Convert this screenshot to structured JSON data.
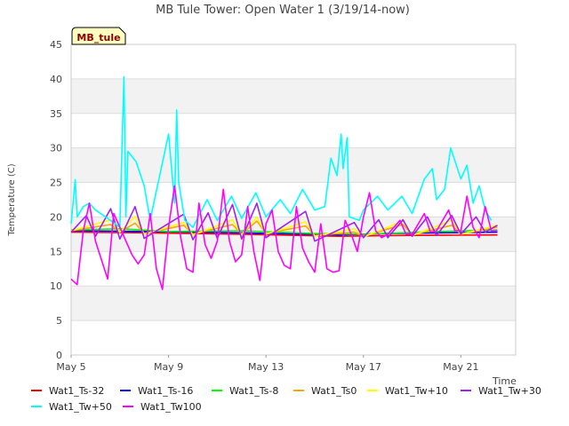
{
  "chart_data": {
    "type": "line",
    "title": "MB Tule Tower: Open Water 1 (3/19/14-now)",
    "xlabel": "Time",
    "ylabel": "Temperature (C)",
    "site_tag": "MB_tule",
    "ylim": [
      0,
      45
    ],
    "xlim": [
      "2014-05-05",
      "2014-05-23T06:00"
    ],
    "y_ticks": [
      0,
      5,
      10,
      15,
      20,
      25,
      30,
      35,
      40,
      45
    ],
    "x_ticks": [
      {
        "date": "2014-05-05",
        "label": "May 5"
      },
      {
        "date": "2014-05-09",
        "label": "May 9"
      },
      {
        "date": "2014-05-13",
        "label": "May 13"
      },
      {
        "date": "2014-05-17",
        "label": "May 17"
      },
      {
        "date": "2014-05-21",
        "label": "May 21"
      }
    ],
    "grid": "horizontal bands",
    "legend_position": "bottom",
    "series": [
      {
        "name": "Wat1_Ts-32",
        "color": "#ff0000",
        "points": [
          [
            "2014-05-05",
            17.8
          ],
          [
            "2014-05-08",
            17.7
          ],
          [
            "2014-05-12",
            17.5
          ],
          [
            "2014-05-16",
            17.2
          ],
          [
            "2014-05-18",
            17.3
          ],
          [
            "2014-05-22T12:00",
            17.4
          ]
        ]
      },
      {
        "name": "Wat1_Ts-16",
        "color": "#0000ff",
        "points": [
          [
            "2014-05-05",
            18.0
          ],
          [
            "2014-05-08",
            17.9
          ],
          [
            "2014-05-12",
            17.7
          ],
          [
            "2014-05-16",
            17.4
          ],
          [
            "2014-05-18",
            17.6
          ],
          [
            "2014-05-22T12:00",
            17.8
          ]
        ]
      },
      {
        "name": "Wat1_Ts-8",
        "color": "#00ff00",
        "points": [
          [
            "2014-05-05",
            18.1
          ],
          [
            "2014-05-07",
            18.3
          ],
          [
            "2014-05-09",
            17.9
          ],
          [
            "2014-05-12",
            18.0
          ],
          [
            "2014-05-15",
            17.6
          ],
          [
            "2014-05-17",
            17.5
          ],
          [
            "2014-05-20",
            17.9
          ],
          [
            "2014-05-22T12:00",
            18.1
          ]
        ]
      },
      {
        "name": "Wat1_Ts0",
        "color": "#ffa500",
        "points": [
          [
            "2014-05-05",
            18.0
          ],
          [
            "2014-05-06T15:00",
            18.9
          ],
          [
            "2014-05-07",
            17.8
          ],
          [
            "2014-05-07T15:00",
            19.1
          ],
          [
            "2014-05-08",
            17.6
          ],
          [
            "2014-05-09T15:00",
            18.8
          ],
          [
            "2014-05-10",
            17.5
          ],
          [
            "2014-05-11T15:00",
            18.9
          ],
          [
            "2014-05-12",
            17.5
          ],
          [
            "2014-05-12T15:00",
            19.4
          ],
          [
            "2014-05-13",
            17.6
          ],
          [
            "2014-05-14T15:00",
            18.7
          ],
          [
            "2014-05-15",
            17.3
          ],
          [
            "2014-05-16T15:00",
            17.8
          ],
          [
            "2014-05-17",
            17.2
          ],
          [
            "2014-05-18T15:00",
            18.9
          ],
          [
            "2014-05-19",
            17.4
          ],
          [
            "2014-05-20T15:00",
            18.8
          ],
          [
            "2014-05-21",
            17.5
          ],
          [
            "2014-05-22T12:00",
            18.5
          ]
        ]
      },
      {
        "name": "Wat1_Tw+10",
        "color": "#ffff00",
        "points": [
          [
            "2014-05-05",
            18.0
          ],
          [
            "2014-05-06T15:00",
            19.6
          ],
          [
            "2014-05-07",
            17.8
          ],
          [
            "2014-05-07T15:00",
            20.1
          ],
          [
            "2014-05-08",
            17.5
          ],
          [
            "2014-05-09T15:00",
            19.2
          ],
          [
            "2014-05-10",
            17.4
          ],
          [
            "2014-05-11T15:00",
            19.6
          ],
          [
            "2014-05-12",
            17.4
          ],
          [
            "2014-05-12T15:00",
            20.0
          ],
          [
            "2014-05-13",
            17.5
          ],
          [
            "2014-05-14T15:00",
            19.3
          ],
          [
            "2014-05-15",
            17.2
          ],
          [
            "2014-05-16T15:00",
            18.3
          ],
          [
            "2014-05-17",
            17.1
          ],
          [
            "2014-05-18T15:00",
            19.4
          ],
          [
            "2014-05-19",
            17.3
          ],
          [
            "2014-05-20T15:00",
            19.5
          ],
          [
            "2014-05-21",
            17.5
          ],
          [
            "2014-05-22T12:00",
            18.8
          ]
        ]
      },
      {
        "name": "Wat1_Tw+30",
        "color": "#a020f0",
        "points": [
          [
            "2014-05-05",
            17.8
          ],
          [
            "2014-05-05T15:00",
            20.2
          ],
          [
            "2014-05-06",
            17.2
          ],
          [
            "2014-05-06T15:00",
            21.2
          ],
          [
            "2014-05-07",
            16.8
          ],
          [
            "2014-05-07T15:00",
            21.5
          ],
          [
            "2014-05-08",
            16.9
          ],
          [
            "2014-05-09T15:00",
            20.4
          ],
          [
            "2014-05-10",
            16.7
          ],
          [
            "2014-05-10T15:00",
            20.6
          ],
          [
            "2014-05-11",
            16.9
          ],
          [
            "2014-05-11T15:00",
            21.8
          ],
          [
            "2014-05-12",
            16.8
          ],
          [
            "2014-05-12T15:00",
            22.0
          ],
          [
            "2014-05-13",
            17.0
          ],
          [
            "2014-05-14T15:00",
            20.8
          ],
          [
            "2014-05-15",
            16.5
          ],
          [
            "2014-05-16T15:00",
            19.2
          ],
          [
            "2014-05-17",
            17.0
          ],
          [
            "2014-05-17T15:00",
            19.6
          ],
          [
            "2014-05-18",
            17.0
          ],
          [
            "2014-05-18T15:00",
            19.6
          ],
          [
            "2014-05-19",
            17.2
          ],
          [
            "2014-05-19T15:00",
            20.0
          ],
          [
            "2014-05-20",
            17.3
          ],
          [
            "2014-05-20T15:00",
            20.2
          ],
          [
            "2014-05-21",
            17.5
          ],
          [
            "2014-05-21T15:00",
            20.0
          ],
          [
            "2014-05-22",
            17.8
          ],
          [
            "2014-05-22T12:00",
            18.8
          ]
        ]
      },
      {
        "name": "Wat1_Tw+50",
        "color": "#00ffff",
        "points": [
          [
            "2014-05-05T00:00",
            19.0
          ],
          [
            "2014-05-05T04:00",
            25.4
          ],
          [
            "2014-05-05T06:00",
            20.0
          ],
          [
            "2014-05-05T12:00",
            21.5
          ],
          [
            "2014-05-05T18:00",
            22.0
          ],
          [
            "2014-05-06T00:00",
            21.0
          ],
          [
            "2014-05-06T12:00",
            19.8
          ],
          [
            "2014-05-07T00:00",
            18.5
          ],
          [
            "2014-05-07T04:00",
            40.3
          ],
          [
            "2014-05-07T06:00",
            20.0
          ],
          [
            "2014-05-07T08:00",
            29.5
          ],
          [
            "2014-05-07T16:00",
            28.0
          ],
          [
            "2014-05-08T00:00",
            24.5
          ],
          [
            "2014-05-08T06:00",
            19.5
          ],
          [
            "2014-05-08T08:00",
            21.0
          ],
          [
            "2014-05-09T00:00",
            32.0
          ],
          [
            "2014-05-09T06:00",
            22.0
          ],
          [
            "2014-05-09T08:00",
            35.5
          ],
          [
            "2014-05-09T10:00",
            25.0
          ],
          [
            "2014-05-09T16:00",
            19.5
          ],
          [
            "2014-05-10T00:00",
            18.5
          ],
          [
            "2014-05-10T14:00",
            22.5
          ],
          [
            "2014-05-11T00:00",
            19.5
          ],
          [
            "2014-05-11T14:00",
            23.0
          ],
          [
            "2014-05-12T00:00",
            19.8
          ],
          [
            "2014-05-12T14:00",
            23.5
          ],
          [
            "2014-05-13T00:00",
            20.0
          ],
          [
            "2014-05-13T14:00",
            22.5
          ],
          [
            "2014-05-14T00:00",
            20.5
          ],
          [
            "2014-05-14T12:00",
            24.0
          ],
          [
            "2014-05-15T00:00",
            21.0
          ],
          [
            "2014-05-15T10:00",
            21.5
          ],
          [
            "2014-05-15T16:00",
            28.5
          ],
          [
            "2014-05-15T22:00",
            26.0
          ],
          [
            "2014-05-16T02:00",
            32.0
          ],
          [
            "2014-05-16T04:00",
            27.0
          ],
          [
            "2014-05-16T08:00",
            31.5
          ],
          [
            "2014-05-16T10:00",
            20.0
          ],
          [
            "2014-05-16T20:00",
            19.5
          ],
          [
            "2014-05-17T00:00",
            21.0
          ],
          [
            "2014-05-17T14:00",
            23.0
          ],
          [
            "2014-05-18T00:00",
            21.0
          ],
          [
            "2014-05-18T14:00",
            23.0
          ],
          [
            "2014-05-19T00:00",
            20.5
          ],
          [
            "2014-05-19T12:00",
            25.5
          ],
          [
            "2014-05-19T20:00",
            27.0
          ],
          [
            "2014-05-20T00:00",
            22.5
          ],
          [
            "2014-05-20T08:00",
            24.0
          ],
          [
            "2014-05-20T14:00",
            30.0
          ],
          [
            "2014-05-21T00:00",
            25.5
          ],
          [
            "2014-05-21T06:00",
            27.5
          ],
          [
            "2014-05-21T12:00",
            22.0
          ],
          [
            "2014-05-21T18:00",
            24.5
          ],
          [
            "2014-05-22T00:00",
            21.0
          ],
          [
            "2014-05-22T06:00",
            19.5
          ]
        ]
      },
      {
        "name": "Wat1_Tw100",
        "color": "#ff00ff",
        "points": [
          [
            "2014-05-05T00:00",
            11.0
          ],
          [
            "2014-05-05T06:00",
            10.2
          ],
          [
            "2014-05-05T12:00",
            18.0
          ],
          [
            "2014-05-05T18:00",
            22.0
          ],
          [
            "2014-05-06T00:00",
            16.5
          ],
          [
            "2014-05-06T12:00",
            11.0
          ],
          [
            "2014-05-06T18:00",
            20.5
          ],
          [
            "2014-05-07T00:00",
            18.5
          ],
          [
            "2014-05-07T12:00",
            14.5
          ],
          [
            "2014-05-07T18:00",
            13.2
          ],
          [
            "2014-05-08T00:00",
            14.5
          ],
          [
            "2014-05-08T06:00",
            20.5
          ],
          [
            "2014-05-08T12:00",
            12.5
          ],
          [
            "2014-05-08T18:00",
            9.5
          ],
          [
            "2014-05-09T00:00",
            18.5
          ],
          [
            "2014-05-09T06:00",
            24.5
          ],
          [
            "2014-05-09T12:00",
            17.0
          ],
          [
            "2014-05-09T18:00",
            12.5
          ],
          [
            "2014-05-10T00:00",
            12.0
          ],
          [
            "2014-05-10T06:00",
            22.0
          ],
          [
            "2014-05-10T12:00",
            16.0
          ],
          [
            "2014-05-10T18:00",
            14.0
          ],
          [
            "2014-05-11T00:00",
            16.5
          ],
          [
            "2014-05-11T06:00",
            24.0
          ],
          [
            "2014-05-11T12:00",
            16.5
          ],
          [
            "2014-05-11T18:00",
            13.5
          ],
          [
            "2014-05-12T00:00",
            14.5
          ],
          [
            "2014-05-12T06:00",
            21.5
          ],
          [
            "2014-05-12T12:00",
            15.0
          ],
          [
            "2014-05-12T18:00",
            10.8
          ],
          [
            "2014-05-13T00:00",
            19.0
          ],
          [
            "2014-05-13T06:00",
            21.0
          ],
          [
            "2014-05-13T12:00",
            15.0
          ],
          [
            "2014-05-13T18:00",
            13.0
          ],
          [
            "2014-05-14T00:00",
            12.5
          ],
          [
            "2014-05-14T06:00",
            21.5
          ],
          [
            "2014-05-14T12:00",
            15.5
          ],
          [
            "2014-05-14T18:00",
            13.5
          ],
          [
            "2014-05-15T00:00",
            12.0
          ],
          [
            "2014-05-15T06:00",
            19.0
          ],
          [
            "2014-05-15T12:00",
            12.5
          ],
          [
            "2014-05-15T18:00",
            12.0
          ],
          [
            "2014-05-16T00:00",
            12.2
          ],
          [
            "2014-05-16T06:00",
            19.5
          ],
          [
            "2014-05-16T12:00",
            17.5
          ],
          [
            "2014-05-16T18:00",
            15.0
          ],
          [
            "2014-05-17T00:00",
            20.0
          ],
          [
            "2014-05-17T06:00",
            23.5
          ],
          [
            "2014-05-17T12:00",
            18.0
          ],
          [
            "2014-05-17T18:00",
            17.0
          ],
          [
            "2014-05-18T00:00",
            17.5
          ],
          [
            "2014-05-18T12:00",
            19.5
          ],
          [
            "2014-05-18T18:00",
            17.5
          ],
          [
            "2014-05-19T00:00",
            17.5
          ],
          [
            "2014-05-19T12:00",
            20.5
          ],
          [
            "2014-05-19T18:00",
            17.8
          ],
          [
            "2014-05-20T00:00",
            18.0
          ],
          [
            "2014-05-20T12:00",
            21.0
          ],
          [
            "2014-05-20T18:00",
            18.0
          ],
          [
            "2014-05-21T00:00",
            18.0
          ],
          [
            "2014-05-21T06:00",
            23.0
          ],
          [
            "2014-05-21T12:00",
            18.5
          ],
          [
            "2014-05-21T18:00",
            17.0
          ],
          [
            "2014-05-22T00:00",
            21.5
          ],
          [
            "2014-05-22T06:00",
            18.0
          ],
          [
            "2014-05-22T12:00",
            18.0
          ]
        ]
      }
    ]
  }
}
